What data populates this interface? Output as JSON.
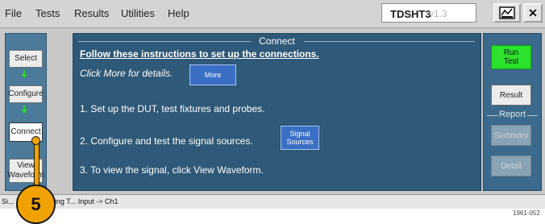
{
  "menu": {
    "items": [
      "File",
      "Tests",
      "Results",
      "Utilities",
      "Help"
    ]
  },
  "title_box": {
    "app": "TDSHT3",
    "version": "v1.3"
  },
  "window_buttons": {
    "minimize_icon": "minimize-icon",
    "close_label": "✕"
  },
  "nav": {
    "select": "Select",
    "configure": "Configure",
    "connect": "Connect",
    "view_waveform_line1": "View",
    "view_waveform_line2": "Waveform"
  },
  "main": {
    "title": "Connect",
    "instructions_heading": "Follow these instructions to set up the connections.",
    "more_prompt": "Click More for details.",
    "more_button": "More",
    "step1": "1. Set up the DUT, test fixtures and probes.",
    "step2": "2. Configure and test the signal sources.",
    "signal_btn_line1": "Signal",
    "signal_btn_line2": "Sources",
    "step3": "3. To view the signal, click View Waveform."
  },
  "right": {
    "run_line1": "Run",
    "run_line2": "Test",
    "result": "Result",
    "report_label": "Report",
    "summary": "Summary",
    "detail": "Detail"
  },
  "status": {
    "text": "Si... Max Diff Swing T...   Input -> Ch1"
  },
  "callout": {
    "number": "5"
  },
  "figure_id": "1961-052",
  "colors": {
    "panel_blue": "#2e5978",
    "run_green": "#2de22d",
    "callout_orange": "#f2a200",
    "button_blue": "#3b6fc6"
  }
}
